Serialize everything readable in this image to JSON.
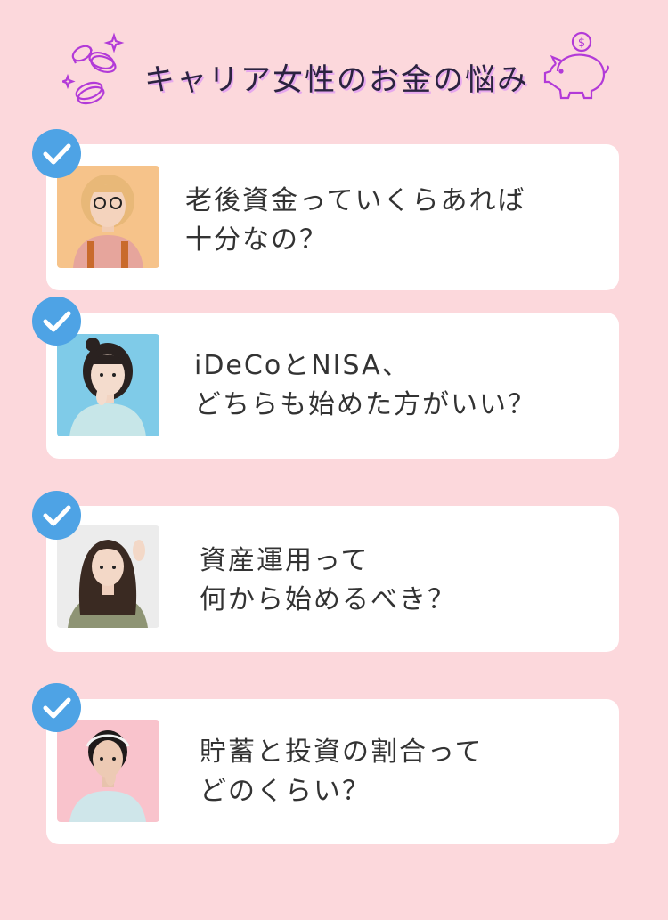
{
  "header": {
    "title": "キャリア女性のお金の悩み"
  },
  "colors": {
    "background": "#fcd8dc",
    "card": "#ffffff",
    "check": "#4ea3e5",
    "accent_purple": "#b23ad8"
  },
  "items": [
    {
      "line1": "老後資金っていくらあれば",
      "line2": "十分なの？",
      "icon": "check-icon"
    },
    {
      "line1": "iDeCoとNISA、",
      "line2": "どちらも始めた方がいい？",
      "icon": "check-icon"
    },
    {
      "line1": "資産運用って",
      "line2": "何から始めるべき？",
      "icon": "check-icon"
    },
    {
      "line1": "貯蓄と投資の割合って",
      "line2": "どのくらい？",
      "icon": "check-icon"
    }
  ]
}
